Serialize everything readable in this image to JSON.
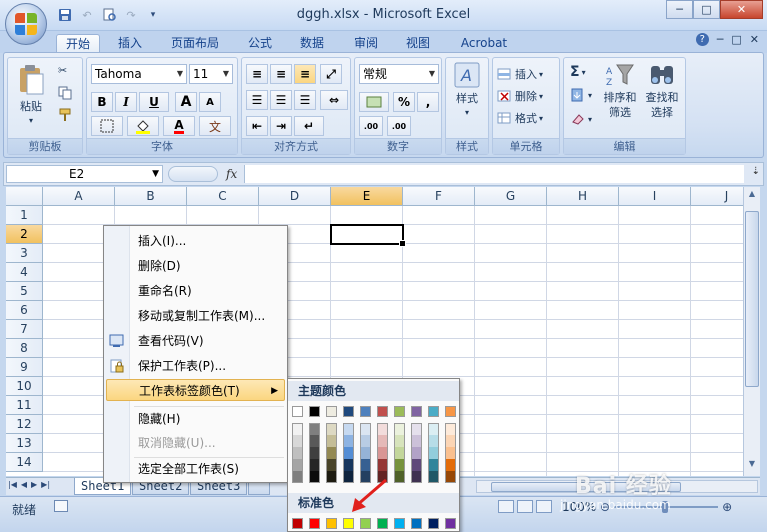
{
  "window": {
    "title": "dggh.xlsx - Microsoft Excel",
    "min": "─",
    "max": "□",
    "close": "✕"
  },
  "ribbon_tabs": [
    "开始",
    "插入",
    "页面布局",
    "公式",
    "数据",
    "审阅",
    "视图",
    "Acrobat"
  ],
  "help_ctl": {
    "help": "?",
    "min": "─",
    "restore": "□",
    "close": "✕"
  },
  "groups": {
    "clipboard": {
      "label": "剪贴板",
      "paste": "粘贴"
    },
    "font": {
      "label": "字体",
      "name": "Tahoma",
      "size": "11",
      "bold": "B",
      "italic": "I",
      "underline": "U",
      "grow": "A",
      "shrink": "A",
      "phonetic": "文"
    },
    "alignment": {
      "label": "对齐方式"
    },
    "number": {
      "label": "数字",
      "format": "常规",
      "percent": "%",
      "comma": ",",
      "inc_decimal": ".00",
      "dec_decimal": ".00"
    },
    "styles": {
      "label": "样式",
      "btn": "样式"
    },
    "cells": {
      "label": "单元格",
      "insert": "插入",
      "delete": "删除",
      "format": "格式"
    },
    "editing": {
      "label": "编辑",
      "sum": "Σ",
      "sort_filter": "排序和\n筛选",
      "find_select": "查找和\n选择"
    }
  },
  "formula_bar": {
    "name_box": "E2",
    "fx": "fx",
    "value": ""
  },
  "columns": [
    "A",
    "B",
    "C",
    "D",
    "E",
    "F",
    "G",
    "H",
    "I",
    "J"
  ],
  "selected_column": "E",
  "rows": [
    "1",
    "2",
    "3",
    "4",
    "5",
    "6",
    "7",
    "8",
    "9",
    "10",
    "11",
    "12",
    "13",
    "14"
  ],
  "selected_row": "2",
  "sheet_tabs": [
    "Sheet1",
    "Sheet2",
    "Sheet3"
  ],
  "statusbar": {
    "ready": "就绪",
    "zoom": "100%"
  },
  "context_menu": {
    "items": [
      {
        "label": "插入(I)...",
        "disabled": false
      },
      {
        "label": "删除(D)",
        "disabled": false
      },
      {
        "label": "重命名(R)",
        "disabled": false
      },
      {
        "label": "移动或复制工作表(M)...",
        "disabled": false
      },
      {
        "label": "查看代码(V)",
        "disabled": false
      },
      {
        "label": "保护工作表(P)...",
        "disabled": false
      },
      {
        "label": "工作表标签颜色(T)",
        "disabled": false
      },
      {
        "label": "隐藏(H)",
        "disabled": false
      },
      {
        "label": "取消隐藏(U)...",
        "disabled": true
      },
      {
        "label": "选定全部工作表(S)",
        "disabled": false
      }
    ]
  },
  "color_menu": {
    "theme_header": "主题颜色",
    "standard_header": "标准色",
    "theme_top": [
      "#ffffff",
      "#000000",
      "#eeece1",
      "#1f497d",
      "#4f81bd",
      "#c0504d",
      "#9bbb59",
      "#8064a2",
      "#4bacc6",
      "#f79646"
    ],
    "theme_shades": [
      [
        "#f2f2f2",
        "#d8d8d8",
        "#bfbfbf",
        "#a5a5a5",
        "#7f7f7f"
      ],
      [
        "#7f7f7f",
        "#595959",
        "#3f3f3f",
        "#262626",
        "#0c0c0c"
      ],
      [
        "#ddd9c3",
        "#c4bd97",
        "#938953",
        "#494429",
        "#1d1b10"
      ],
      [
        "#c6d9f0",
        "#8db3e2",
        "#548dd4",
        "#17365d",
        "#0f243e"
      ],
      [
        "#dbe5f1",
        "#b8cce4",
        "#95b3d7",
        "#366092",
        "#244061"
      ],
      [
        "#f2dcdb",
        "#e5b9b7",
        "#d99694",
        "#953734",
        "#632423"
      ],
      [
        "#ebf1dd",
        "#d7e3bc",
        "#c3d69b",
        "#76923c",
        "#4f6128"
      ],
      [
        "#e5e0ec",
        "#ccc1d9",
        "#b2a2c7",
        "#5f497a",
        "#3f3151"
      ],
      [
        "#dbeef3",
        "#b7dde8",
        "#92cddc",
        "#31859b",
        "#205867"
      ],
      [
        "#fdeada",
        "#fbd5b5",
        "#fac08f",
        "#e36c09",
        "#974806"
      ]
    ],
    "standard": [
      "#c00000",
      "#ff0000",
      "#ffc000",
      "#ffff00",
      "#92d050",
      "#00b050",
      "#00b0f0",
      "#0070c0",
      "#002060",
      "#7030a0"
    ]
  },
  "watermark": {
    "main": "Bai 经验",
    "sub": "jingyan.baidu.com"
  }
}
